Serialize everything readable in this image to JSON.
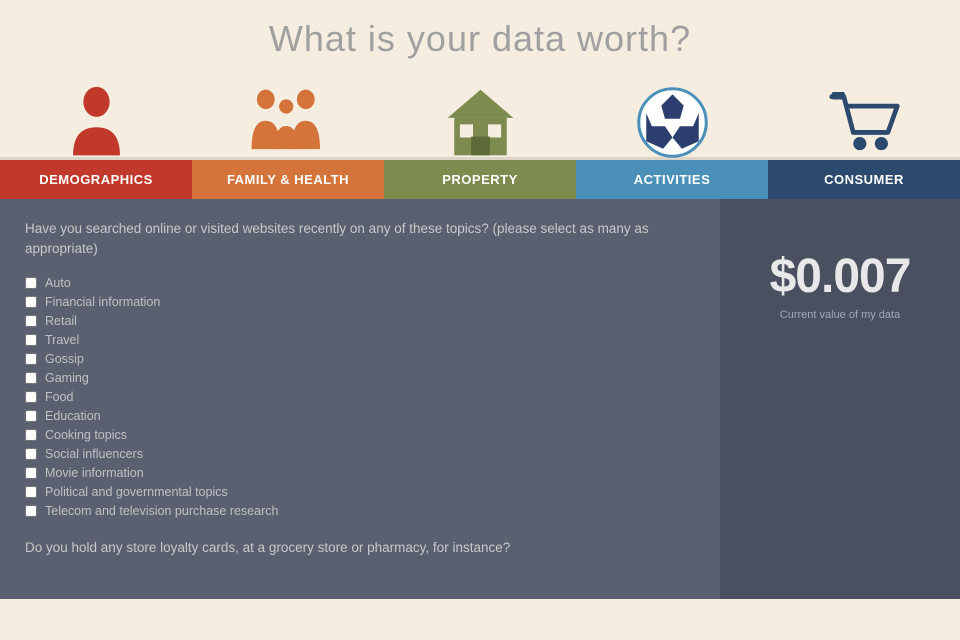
{
  "header": {
    "title": "What is your data worth?"
  },
  "nav": {
    "tabs": [
      {
        "id": "demographics",
        "label": "DEMOGRAPHICS",
        "class": "tab-demographics"
      },
      {
        "id": "family",
        "label": "FAMILY & HEALTH",
        "class": "tab-family"
      },
      {
        "id": "property",
        "label": "PROPERTY",
        "class": "tab-property"
      },
      {
        "id": "activities",
        "label": "ACTIVITIES",
        "class": "tab-activities"
      },
      {
        "id": "consumer",
        "label": "CONSUMER",
        "class": "tab-consumer"
      }
    ]
  },
  "main": {
    "question1": "Have you searched online or visited websites recently on any of these topics? (please select as many as appropriate)",
    "checkboxes": [
      "Auto",
      "Financial information",
      "Retail",
      "Travel",
      "Gossip",
      "Gaming",
      "Food",
      "Education",
      "Cooking topics",
      "Social influencers",
      "Movie information",
      "Political and governmental topics",
      "Telecom and television purchase research"
    ],
    "question2": "Do you hold any store loyalty cards, at a grocery store or pharmacy, for instance?",
    "data_value": "$0.007",
    "data_label": "Current value of my data"
  }
}
